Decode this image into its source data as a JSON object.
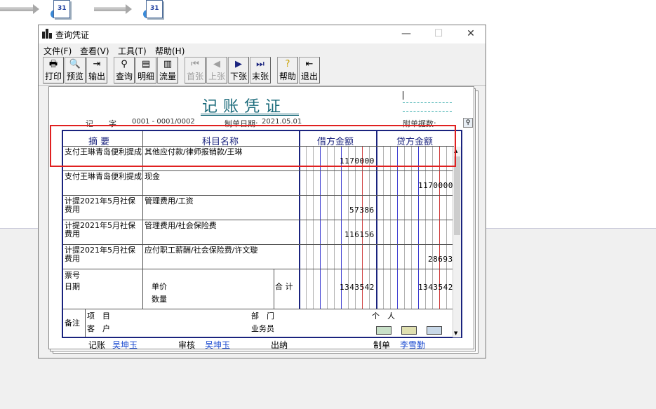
{
  "window": {
    "title": "查询凭证"
  },
  "menu": [
    "文件(F)",
    "查看(V)",
    "工具(T)",
    "帮助(H)"
  ],
  "toolbar": {
    "print": "打印",
    "preview": "预览",
    "export": "输出",
    "query": "查询",
    "detail": "明细",
    "flow": "流量",
    "first": "首张",
    "prev": "上张",
    "next": "下张",
    "last": "末张",
    "help": "帮助",
    "exit": "退出"
  },
  "voucher": {
    "title": "记账凭证",
    "word_label": "记　　字",
    "number": "0001 - 0001/0002",
    "date_label": "制单日期:",
    "date": "2021.05.01",
    "attach_label": "附单据数:"
  },
  "columns": {
    "summary": "摘 要",
    "account": "科目名称",
    "debit": "借方金额",
    "credit": "贷方金额"
  },
  "rows": [
    {
      "summary": "支付王琳青岛便利提成",
      "account": "其他应付款/律师报销款/王琳",
      "debit": "1170000",
      "credit": ""
    },
    {
      "summary": "支付王琳青岛便利提成",
      "account": "现金",
      "debit": "",
      "credit": "1170000"
    },
    {
      "summary": "计提2021年5月社保费用",
      "account": "管理费用/工资",
      "debit": "57386",
      "credit": ""
    },
    {
      "summary": "计提2021年5月社保费用",
      "account": "管理费用/社会保险费",
      "debit": "116156",
      "credit": ""
    },
    {
      "summary": "计提2021年5月社保费用",
      "account": "应付职工薪酬/社会保险费/许文璇",
      "debit": "",
      "credit": "28693"
    }
  ],
  "footer": {
    "ticket_no": "票号",
    "date": "日期",
    "unit_price": "单价",
    "quantity": "数量",
    "total_label": "合 计",
    "total_debit": "1343542",
    "total_credit": "1343542",
    "remark": "备注",
    "project": "项　目",
    "customer": "客　户",
    "department": "部　门",
    "salesperson": "业务员",
    "person": "个　人"
  },
  "signatures": {
    "bookkeeper_label": "记账",
    "bookkeeper": "吴坤玉",
    "reviewer_label": "审核",
    "reviewer": "吴坤玉",
    "cashier_label": "出纳",
    "maker_label": "制单",
    "maker": "李雪勤"
  }
}
